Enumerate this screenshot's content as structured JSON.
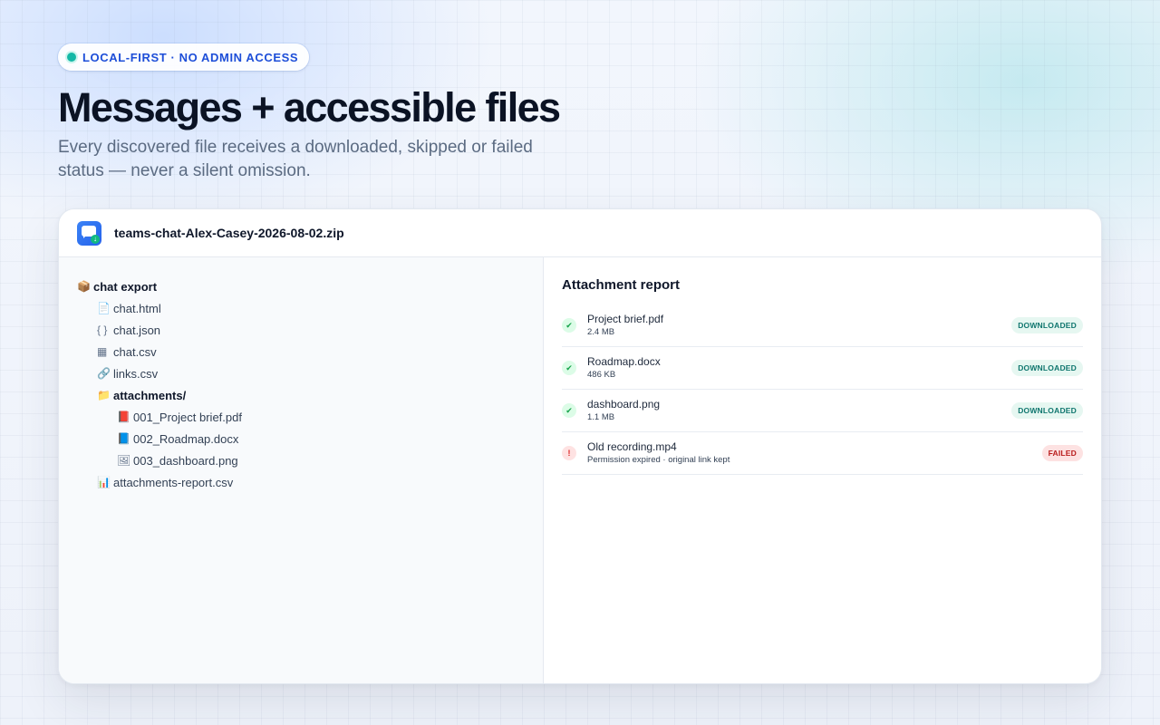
{
  "badge": {
    "label": "LOCAL-FIRST · NO ADMIN ACCESS"
  },
  "headline": "Messages + accessible files",
  "subheadline": "Every discovered file receives a downloaded, skipped or failed status — never a silent omission.",
  "card": {
    "file_name": "teams-chat-Alex-Casey-2026-08-02.zip",
    "app_icon": "chat-download-icon"
  },
  "tree": {
    "root": {
      "icon": "📦",
      "label": "chat export"
    },
    "items": [
      {
        "icon": "📄",
        "label": "chat.html"
      },
      {
        "icon": "{ }",
        "label": "chat.json"
      },
      {
        "icon": "▦",
        "label": "chat.csv"
      },
      {
        "icon": "🔗",
        "label": "links.csv"
      },
      {
        "icon": "📁",
        "label": "attachments/"
      },
      {
        "icon": "📕",
        "label": "001_Project brief.pdf"
      },
      {
        "icon": "📘",
        "label": "002_Roadmap.docx"
      },
      {
        "icon": "🖼",
        "label": "003_dashboard.png"
      },
      {
        "icon": "📊",
        "label": "attachments-report.csv"
      }
    ]
  },
  "report": {
    "title": "Attachment report",
    "rows": [
      {
        "name": "Project brief.pdf",
        "detail": "2.4 MB",
        "status": "DOWNLOADED",
        "icon": "✔"
      },
      {
        "name": "Roadmap.docx",
        "detail": "486 KB",
        "status": "DOWNLOADED",
        "icon": "✔"
      },
      {
        "name": "dashboard.png",
        "detail": "1.1 MB",
        "status": "DOWNLOADED",
        "icon": "✔"
      },
      {
        "name": "Old recording.mp4",
        "detail": "Permission expired · original link kept",
        "status": "FAILED",
        "icon": "!"
      }
    ]
  },
  "colors": {
    "accent": "#1d4ed8",
    "success": "#16a34a",
    "failure": "#dc2626"
  }
}
